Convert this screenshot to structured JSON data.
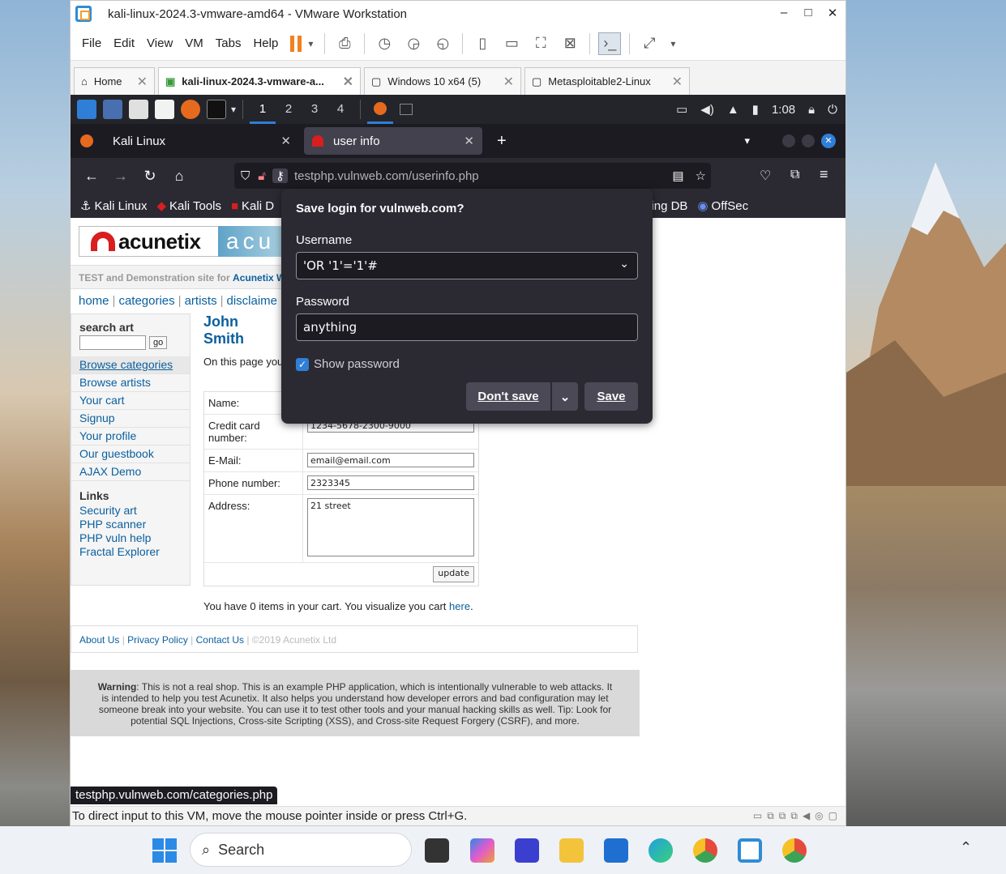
{
  "vmware": {
    "title": "kali-linux-2024.3-vmware-amd64 - VMware Workstation",
    "window_controls": {
      "minimize": "–",
      "maximize": "□",
      "close": "✕"
    },
    "menu": [
      "File",
      "Edit",
      "View",
      "VM",
      "Tabs",
      "Help"
    ],
    "tabs": [
      {
        "label": "Home",
        "icon": "home-icon"
      },
      {
        "label": "kali-linux-2024.3-vmware-a...",
        "icon": "vm-running-icon",
        "active": true
      },
      {
        "label": "Windows 10 x64 (5)",
        "icon": "vm-icon"
      },
      {
        "label": "Metasploitable2-Linux",
        "icon": "vm-icon"
      }
    ],
    "status_text": "To direct input to this VM, move the mouse pointer inside or press Ctrl+G."
  },
  "kali_panel": {
    "workspaces": [
      "1",
      "2",
      "3",
      "4"
    ],
    "active_workspace": "1",
    "clock": "1:08"
  },
  "firefox": {
    "tabs": [
      {
        "label": "Kali Linux"
      },
      {
        "label": "user info",
        "active": true
      }
    ],
    "new_tab": "+",
    "url_host": "testphp.vulnweb.com",
    "url_path": "/userinfo.php",
    "bookmarks": [
      "Kali Linux",
      "Kali Tools",
      "Kali D",
      "acking DB",
      "OffSec"
    ],
    "status_link": "testphp.vulnweb.com/categories.php"
  },
  "site": {
    "logo_word": "acunetix",
    "banner_text": "acu",
    "tagline_prefix": "TEST and Demonstration site for",
    "tagline_brand": "Acunetix W",
    "topnav": [
      "home",
      "categories",
      "artists",
      "disclaime"
    ],
    "search_label": "search art",
    "search_go": "go",
    "sidebar_links": [
      "Browse categories",
      "Browse artists",
      "Your cart",
      "Signup",
      "Your profile",
      "Our guestbook",
      "AJAX Demo"
    ],
    "links_heading": "Links",
    "extra_links": [
      "Security art",
      "PHP scanner",
      "PHP vuln help",
      "Fractal Explorer"
    ],
    "user_heading": "John Smith",
    "intro_text": "On this page you",
    "fields": [
      {
        "label": "Name:",
        "value": ""
      },
      {
        "label": "Credit card number:",
        "value": "1234-5678-2300-9000"
      },
      {
        "label": "E-Mail:",
        "value": "email@email.com"
      },
      {
        "label": "Phone number:",
        "value": "2323345"
      },
      {
        "label": "Address:",
        "value": "21 street"
      }
    ],
    "update_button": "update",
    "cart_text": "You have 0 items in your cart. You visualize you cart",
    "cart_link": "here",
    "cart_end": ".",
    "footer_links": [
      "About Us",
      "Privacy Policy",
      "Contact Us"
    ],
    "footer_copyright": "©2019 Acunetix Ltd",
    "warning_bold": "Warning",
    "warning_text": ": This is not a real shop. This is an example PHP application, which is intentionally vulnerable to web attacks. It is intended to help you test Acunetix. It also helps you understand how developer errors and bad configuration may let someone break into your website. You can use it to test other tools and your manual hacking skills as well. Tip: Look for potential SQL Injections, Cross-site Scripting (XSS), and Cross-site Request Forgery (CSRF), and more."
  },
  "save_login": {
    "title": "Save login for vulnweb.com?",
    "username_label": "Username",
    "username_value": "'OR '1'='1'#",
    "password_label": "Password",
    "password_value": "anything",
    "show_password": "Show password",
    "dont_save": "Don't save",
    "save": "Save"
  },
  "taskbar": {
    "search_placeholder": "Search"
  }
}
